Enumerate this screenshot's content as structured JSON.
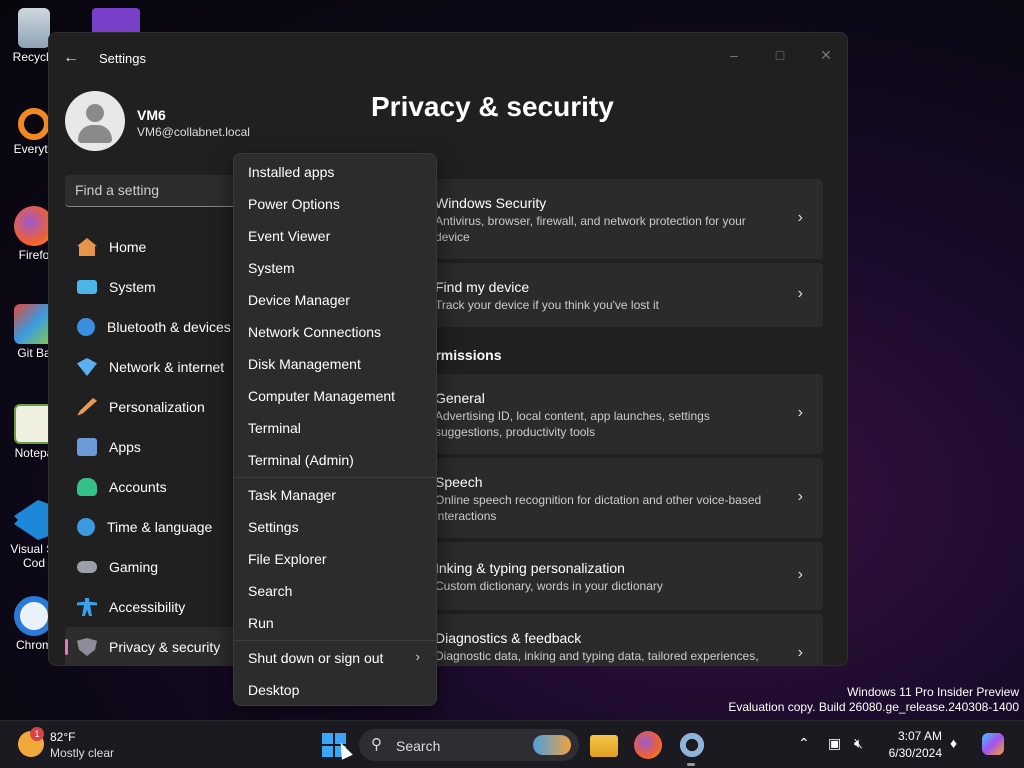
{
  "desktop": {
    "icons": [
      {
        "label": "Recycle"
      },
      {
        "label": "Everyth"
      },
      {
        "label": "Firefo"
      },
      {
        "label": "Git Ba"
      },
      {
        "label": "Notepa"
      },
      {
        "label": "Visual St Cod"
      },
      {
        "label": "Chrom"
      }
    ]
  },
  "window": {
    "title": "Settings",
    "user": {
      "name": "VM6",
      "email": "VM6@collabnet.local"
    },
    "search_placeholder": "Find a setting",
    "nav": [
      {
        "label": "Home",
        "icon": "home-icon",
        "color": "#e8954b"
      },
      {
        "label": "System",
        "icon": "monitor-icon",
        "color": "#4cb6e8"
      },
      {
        "label": "Bluetooth & devices",
        "icon": "bluetooth-icon",
        "color": "#3a8fe0"
      },
      {
        "label": "Network & internet",
        "icon": "wifi-icon",
        "color": "#5ab0f0"
      },
      {
        "label": "Personalization",
        "icon": "brush-icon",
        "color": "#e89a5a"
      },
      {
        "label": "Apps",
        "icon": "apps-icon",
        "color": "#6a9ad8"
      },
      {
        "label": "Accounts",
        "icon": "person-icon",
        "color": "#35c08a"
      },
      {
        "label": "Time & language",
        "icon": "globe-clock-icon",
        "color": "#3a9ae0"
      },
      {
        "label": "Gaming",
        "icon": "gamepad-icon",
        "color": "#9aa0a8"
      },
      {
        "label": "Accessibility",
        "icon": "accessibility-icon",
        "color": "#3aa0f0"
      },
      {
        "label": "Privacy & security",
        "icon": "shield-icon",
        "color": "#8d8d99"
      }
    ],
    "page_title": "Privacy & security",
    "cards_top": [
      {
        "title": "Windows Security",
        "desc": "Antivirus, browser, firewall, and network protection for your device"
      },
      {
        "title": "Find my device",
        "desc": "Track your device if you think you've lost it"
      }
    ],
    "section_heading": "permissions",
    "cards_bottom": [
      {
        "title": "General",
        "desc": "Advertising ID, local content, app launches, settings suggestions, productivity tools"
      },
      {
        "title": "Speech",
        "desc": "Online speech recognition for dictation and other voice-based interactions"
      },
      {
        "title": "Inking & typing personalization",
        "desc": "Custom dictionary, words in your dictionary"
      },
      {
        "title": "Diagnostics & feedback",
        "desc": "Diagnostic data, inking and typing data, tailored experiences,"
      }
    ]
  },
  "context_menu": {
    "items": [
      "Installed apps",
      "Power Options",
      "Event Viewer",
      "System",
      "Device Manager",
      "Network Connections",
      "Disk Management",
      "Computer Management",
      "Terminal",
      "Terminal (Admin)",
      "Task Manager",
      "Settings",
      "File Explorer",
      "Search",
      "Run",
      "Shut down or sign out",
      "Desktop"
    ]
  },
  "watermark": {
    "line1": "Windows 11 Pro Insider Preview",
    "line2": "Evaluation copy. Build 26080.ge_release.240308-1400"
  },
  "taskbar": {
    "weather": {
      "temp": "82°F",
      "condition": "Mostly clear",
      "badge": "1"
    },
    "search_label": "Search",
    "clock": {
      "time": "3:07 AM",
      "date": "6/30/2024"
    }
  }
}
